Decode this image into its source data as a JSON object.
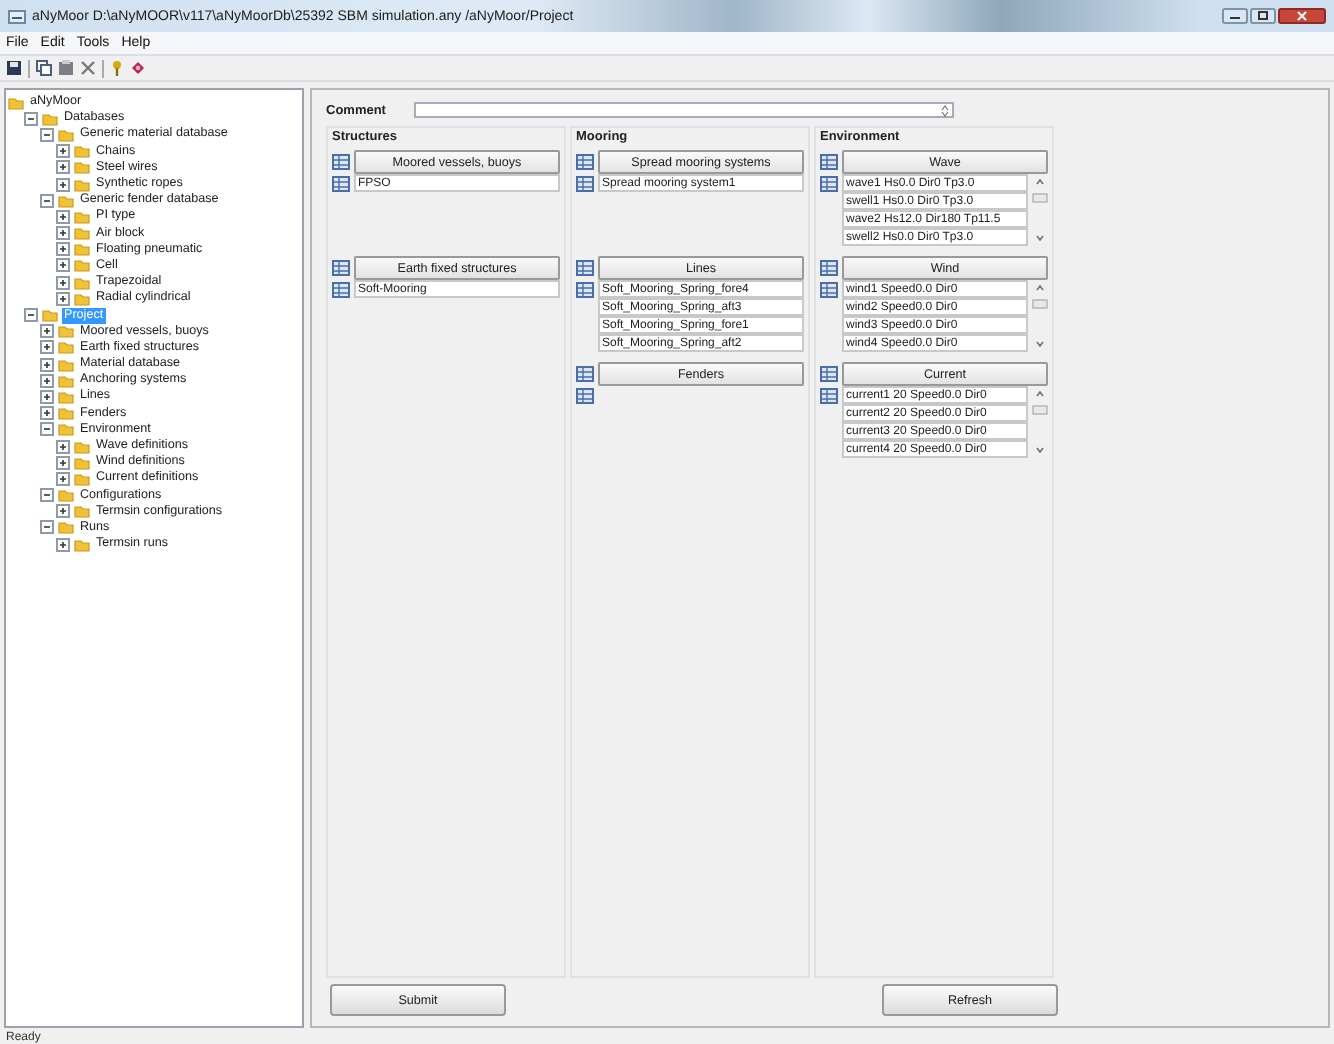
{
  "window": {
    "title": "aNyMoor D:\\aNyMOOR\\v117\\aNyMoorDb\\25392 SBM simulation.any   /aNyMoor/Project"
  },
  "menu": [
    "File",
    "Edit",
    "Tools",
    "Help"
  ],
  "tree": [
    {
      "label": "aNyMoor",
      "selected": false,
      "children": [
        {
          "label": "Databases",
          "expanded": true,
          "selected": false,
          "children": [
            {
              "label": "Generic material database",
              "expanded": true,
              "selected": false,
              "children": [
                {
                  "label": "Chains",
                  "expanded": false,
                  "selected": false
                },
                {
                  "label": "Steel wires",
                  "expanded": false,
                  "selected": false
                },
                {
                  "label": "Synthetic ropes",
                  "expanded": false,
                  "selected": false
                }
              ]
            },
            {
              "label": "Generic fender database",
              "expanded": true,
              "selected": false,
              "children": [
                {
                  "label": "PI type",
                  "expanded": false,
                  "selected": false
                },
                {
                  "label": "Air block",
                  "expanded": false,
                  "selected": false
                },
                {
                  "label": "Floating pneumatic",
                  "expanded": false,
                  "selected": false
                },
                {
                  "label": "Cell",
                  "expanded": false,
                  "selected": false
                },
                {
                  "label": "Trapezoidal",
                  "expanded": false,
                  "selected": false
                },
                {
                  "label": "Radial cylindrical",
                  "expanded": false,
                  "selected": false
                }
              ]
            }
          ]
        },
        {
          "label": "Project",
          "expanded": true,
          "selected": true,
          "children": [
            {
              "label": "Moored vessels, buoys",
              "expanded": false,
              "selected": false
            },
            {
              "label": "Earth fixed structures",
              "expanded": false,
              "selected": false
            },
            {
              "label": "Material database",
              "expanded": false,
              "selected": false
            },
            {
              "label": "Anchoring systems",
              "expanded": false,
              "selected": false
            },
            {
              "label": "Lines",
              "expanded": false,
              "selected": false
            },
            {
              "label": "Fenders",
              "expanded": false,
              "selected": false
            },
            {
              "label": "Environment",
              "expanded": true,
              "selected": false,
              "children": [
                {
                  "label": "Wave definitions",
                  "expanded": false,
                  "selected": false
                },
                {
                  "label": "Wind definitions",
                  "expanded": false,
                  "selected": false
                },
                {
                  "label": "Current definitions",
                  "expanded": false,
                  "selected": false
                }
              ]
            },
            {
              "label": "Configurations",
              "expanded": true,
              "selected": false,
              "children": [
                {
                  "label": "Termsin configurations",
                  "expanded": false,
                  "selected": false
                }
              ]
            },
            {
              "label": "Runs",
              "expanded": true,
              "selected": false,
              "children": [
                {
                  "label": "Termsin runs",
                  "expanded": false,
                  "selected": false
                }
              ]
            }
          ]
        }
      ]
    }
  ],
  "comment": {
    "label": "Comment"
  },
  "columns": [
    {
      "title": "Structures",
      "groups": [
        {
          "button": "Moored vessels, buoys",
          "scrollable": false,
          "items": [
            "FPSO"
          ]
        },
        {
          "button": "Earth fixed structures",
          "scrollable": false,
          "items": [
            "Soft-Mooring"
          ]
        }
      ]
    },
    {
      "title": "Mooring",
      "groups": [
        {
          "button": "Spread mooring systems",
          "scrollable": false,
          "items": [
            "Spread mooring system1"
          ]
        },
        {
          "button": "Lines",
          "scrollable": false,
          "items": [
            "Soft_Mooring_Spring_fore4",
            "Soft_Mooring_Spring_aft3",
            "Soft_Mooring_Spring_fore1",
            "Soft_Mooring_Spring_aft2"
          ]
        },
        {
          "button": "Fenders",
          "scrollable": false
        }
      ]
    },
    {
      "title": "Environment",
      "groups": [
        {
          "button": "Wave",
          "scrollable": true,
          "items": [
            "wave1 Hs0.0 Dir0 Tp3.0",
            "swell1 Hs0.0 Dir0 Tp3.0",
            "wave2 Hs12.0 Dir180 Tp11.5",
            "swell2 Hs0.0 Dir0 Tp3.0"
          ]
        },
        {
          "button": "Wind",
          "scrollable": true,
          "items": [
            "wind1 Speed0.0 Dir0",
            "wind2 Speed0.0 Dir0",
            "wind3 Speed0.0 Dir0",
            "wind4 Speed0.0 Dir0"
          ]
        },
        {
          "button": "Current",
          "scrollable": true,
          "items": [
            "current1 20 Speed0.0 Dir0",
            "current2 20 Speed0.0 Dir0",
            "current3 20 Speed0.0 Dir0",
            "current4 20 Speed0.0 Dir0"
          ]
        }
      ]
    }
  ],
  "buttons": [
    "Submit",
    "Refresh"
  ],
  "status_bar": "Ready"
}
